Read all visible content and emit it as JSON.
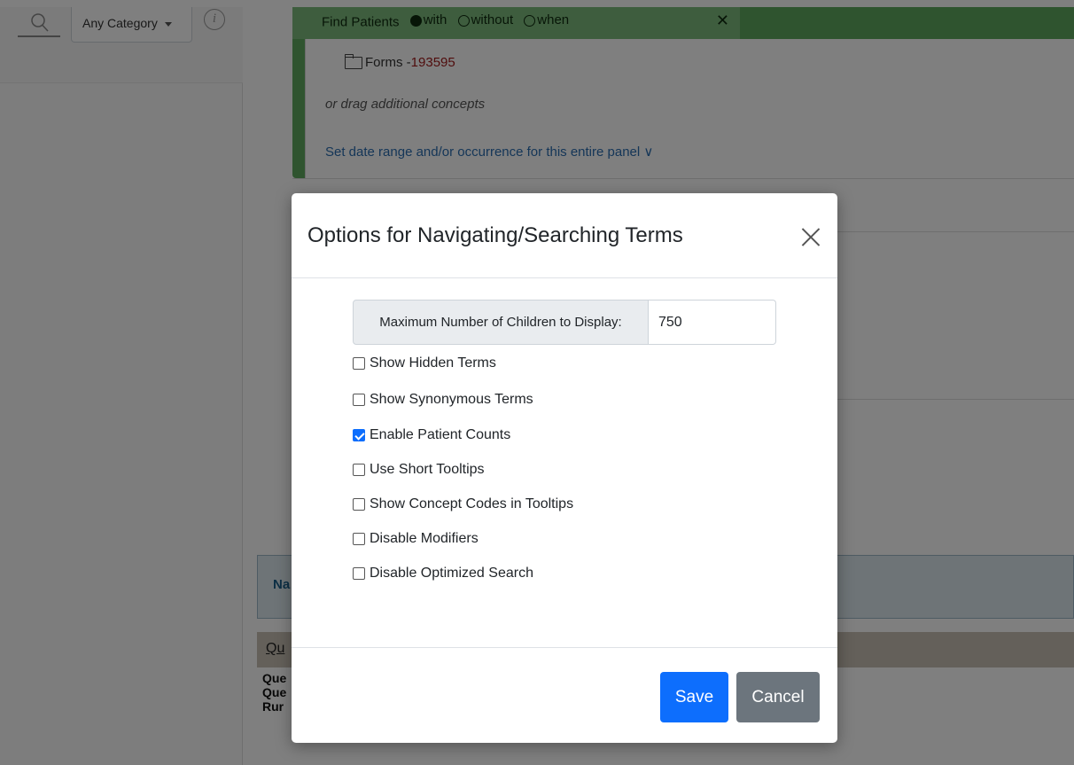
{
  "left_panel": {
    "category_select": "Any Category",
    "info_symbol": "i"
  },
  "query_panel": {
    "header_label": "Find Patients",
    "options": [
      "with",
      "without",
      "when"
    ],
    "selected_option": "with",
    "close_symbol": "✕",
    "concept_label": "Forms - ",
    "concept_count": "193595",
    "drag_hint": "or drag additional concepts",
    "date_range_link": "Set date range and/or occurrence for this entire panel ∨"
  },
  "nav_bar": {
    "label": "Na"
  },
  "query_tab": {
    "label": "Qu"
  },
  "query_info": {
    "lines": [
      "Que",
      "Que",
      "Rur"
    ]
  },
  "modal": {
    "title": "Options for Navigating/Searching Terms",
    "max_children_label": "Maximum Number of Children to Display:",
    "max_children_value": "750",
    "checkboxes": [
      {
        "label": "Show Hidden Terms",
        "checked": false
      },
      {
        "label": "Show Synonymous Terms",
        "checked": false
      },
      {
        "label": "Enable Patient Counts",
        "checked": true
      },
      {
        "label": "Use Short Tooltips",
        "checked": false
      },
      {
        "label": "Show Concept Codes in Tooltips",
        "checked": false
      },
      {
        "label": "Disable Modifiers",
        "checked": false
      },
      {
        "label": "Disable Optimized Search",
        "checked": false
      }
    ],
    "save_label": "Save",
    "cancel_label": "Cancel"
  },
  "colors": {
    "primary": "#0d6efd",
    "secondary": "#6c757d",
    "panel_green": "#5fa95f",
    "backdrop": "rgba(0,0,0,0.5)"
  }
}
